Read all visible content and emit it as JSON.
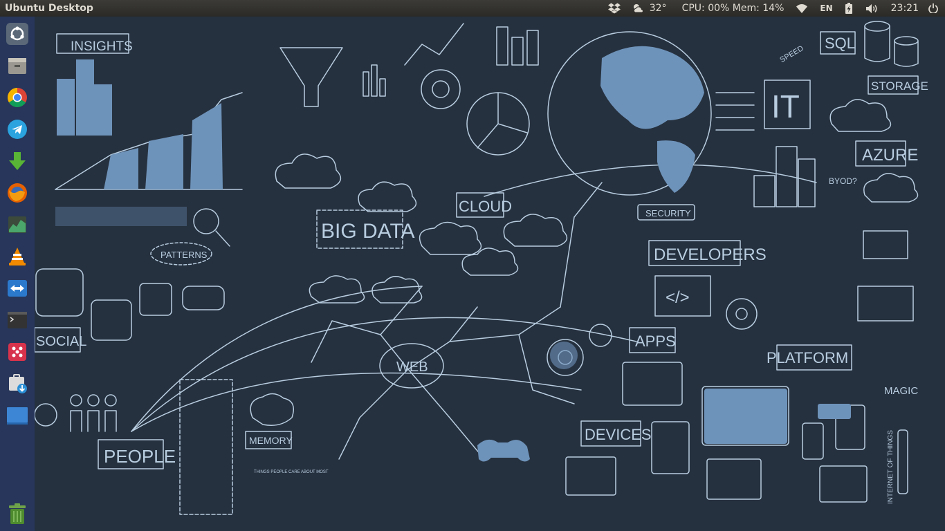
{
  "panel": {
    "app_title": "Ubuntu Desktop",
    "weather_temp": "32°",
    "system_monitor": "CPU: 00% Mem: 14%",
    "keyboard_layout": "EN",
    "clock": "23:21"
  },
  "launcher": {
    "items": [
      {
        "name": "Ubuntu Dash",
        "icon": "ubuntu-logo-icon"
      },
      {
        "name": "Files",
        "icon": "files-icon"
      },
      {
        "name": "Google Chrome",
        "icon": "chrome-icon"
      },
      {
        "name": "Telegram",
        "icon": "telegram-icon"
      },
      {
        "name": "Downloader",
        "icon": "download-arrow-icon"
      },
      {
        "name": "Firefox",
        "icon": "firefox-icon"
      },
      {
        "name": "System Monitor",
        "icon": "system-monitor-icon"
      },
      {
        "name": "VLC",
        "icon": "vlc-icon"
      },
      {
        "name": "Remote Desktop",
        "icon": "remote-desktop-icon"
      },
      {
        "name": "Terminal",
        "icon": "terminal-icon"
      },
      {
        "name": "Screen Grabber",
        "icon": "grab-icon"
      },
      {
        "name": "Software Installer",
        "icon": "package-install-icon"
      },
      {
        "name": "Show Desktop",
        "icon": "show-desktop-icon"
      },
      {
        "name": "Trash",
        "icon": "trash-icon"
      }
    ]
  },
  "wallpaper": {
    "labels": {
      "insights": "INSIGHTS",
      "big_data": "BIG DATA",
      "cloud": "CLOUD",
      "patterns": "PATTERNS",
      "social": "SOCIAL",
      "people": "PEOPLE",
      "memory": "MEMORY",
      "web": "WEB",
      "devices": "DEVICES",
      "apps": "APPS",
      "developers": "DEVELOPERS",
      "security": "SECURITY",
      "platform": "PLATFORM",
      "magic": "MAGIC",
      "it": "IT",
      "sql": "SQL",
      "storage": "STORAGE",
      "azure": "AZURE",
      "byod": "BYOD?",
      "speed": "SPEED",
      "iot": "INTERNET OF THINGS",
      "code": "</>",
      "things_people": "THINGS PEOPLE CARE ABOUT MOST"
    },
    "colors": {
      "background": "#26313f",
      "ink": "#b8cde0",
      "fill": "#6e93ba"
    }
  }
}
